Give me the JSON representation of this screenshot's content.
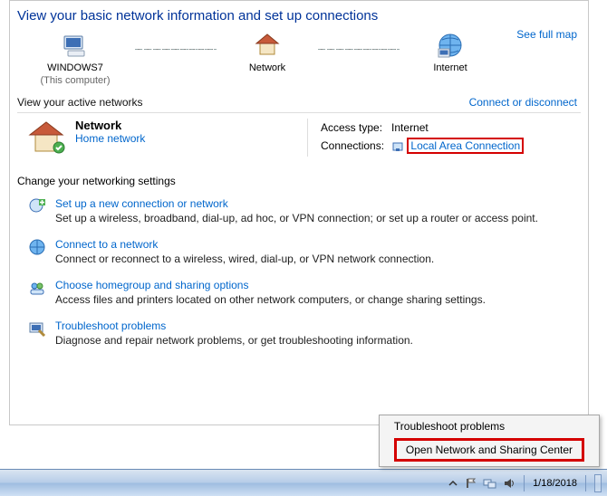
{
  "heading": "View your basic network information and set up connections",
  "see_full_map": "See full map",
  "map": {
    "this_pc": "WINDOWS7",
    "this_pc_sub": "(This computer)",
    "network": "Network",
    "internet": "Internet"
  },
  "active_header": "View your active networks",
  "connect_disconnect": "Connect or disconnect",
  "active_network": {
    "name": "Network",
    "category": "Home network",
    "access_label": "Access type:",
    "access_value": "Internet",
    "conn_label": "Connections:",
    "conn_value": "Local Area Connection"
  },
  "change_header": "Change your networking settings",
  "tasks": [
    {
      "title": "Set up a new connection or network",
      "desc": "Set up a wireless, broadband, dial-up, ad hoc, or VPN connection; or set up a router or access point."
    },
    {
      "title": "Connect to a network",
      "desc": "Connect or reconnect to a wireless, wired, dial-up, or VPN network connection."
    },
    {
      "title": "Choose homegroup and sharing options",
      "desc": "Access files and printers located on other network computers, or change sharing settings."
    },
    {
      "title": "Troubleshoot problems",
      "desc": "Diagnose and repair network problems, or get troubleshooting information."
    }
  ],
  "context_menu": {
    "troubleshoot": "Troubleshoot problems",
    "open_center": "Open Network and Sharing Center"
  },
  "tray": {
    "date": "1/18/2018"
  }
}
